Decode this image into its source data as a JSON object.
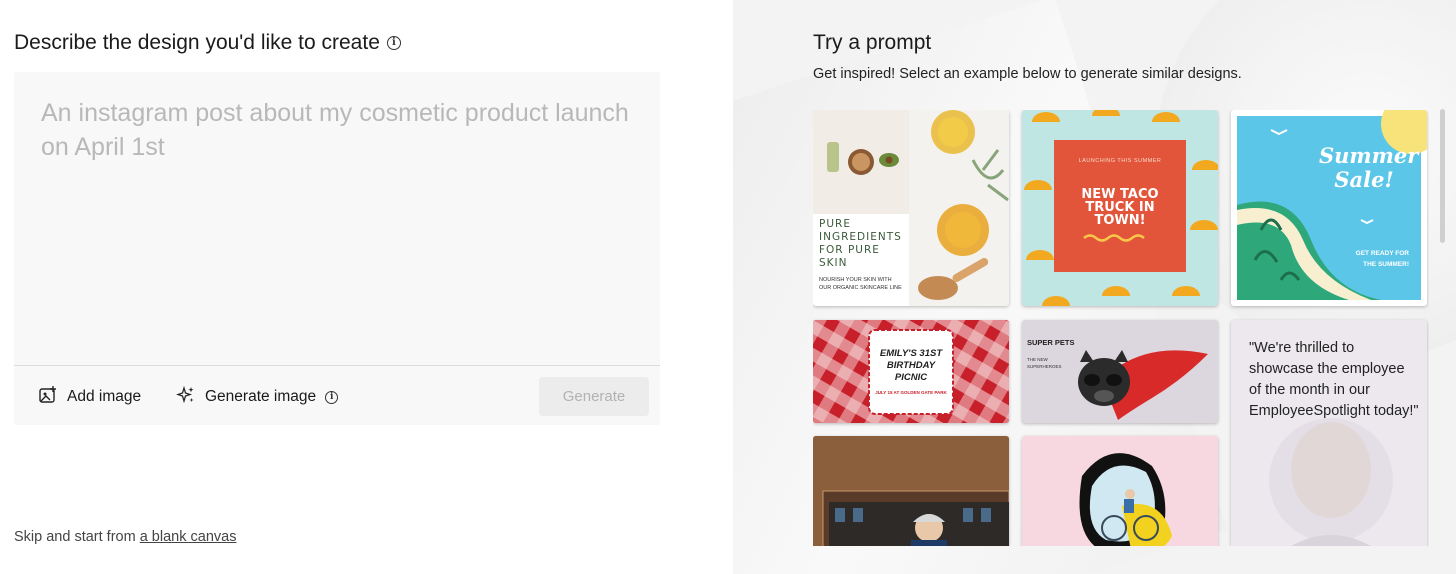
{
  "left": {
    "heading": "Describe the design you'd like to create",
    "prompt_placeholder": "An instagram post about my cosmetic product launch on April 1st",
    "add_image_label": "Add image",
    "generate_image_label": "Generate image",
    "generate_button_label": "Generate",
    "skip_prefix": "Skip and start from ",
    "skip_link": "a blank canvas"
  },
  "right": {
    "title": "Try a prompt",
    "subtitle": "Get inspired! Select an example below to generate similar designs.",
    "cards": {
      "pure": {
        "title": "PURE INGREDIENTS FOR PURE SKIN",
        "sub": "NOURISH YOUR SKIN WITH OUR ORGANIC SKINCARE LINE"
      },
      "taco": {
        "kicker": "LAUNCHING THIS SUMMER",
        "title": "NEW TACO TRUCK IN TOWN!"
      },
      "summer": {
        "title": "Summer Sale!",
        "sub": "GET READY FOR THE SUMMER!"
      },
      "birthday": {
        "title": "EMILY'S 31ST BIRTHDAY PICNIC",
        "sub": "JULY 15 AT GOLDEN GATE PARK"
      },
      "pets": {
        "title": "SUPER PETS",
        "sub": "THE NEW SUPERHEROES"
      },
      "quote": {
        "text": "\"We're thrilled to showcase the employee of the month in our EmployeeSpotlight today!\""
      }
    },
    "colors": {
      "taco_red": "#e2553a",
      "summer_sky": "#5cc6e8",
      "gingham_red": "#c8202a"
    }
  }
}
